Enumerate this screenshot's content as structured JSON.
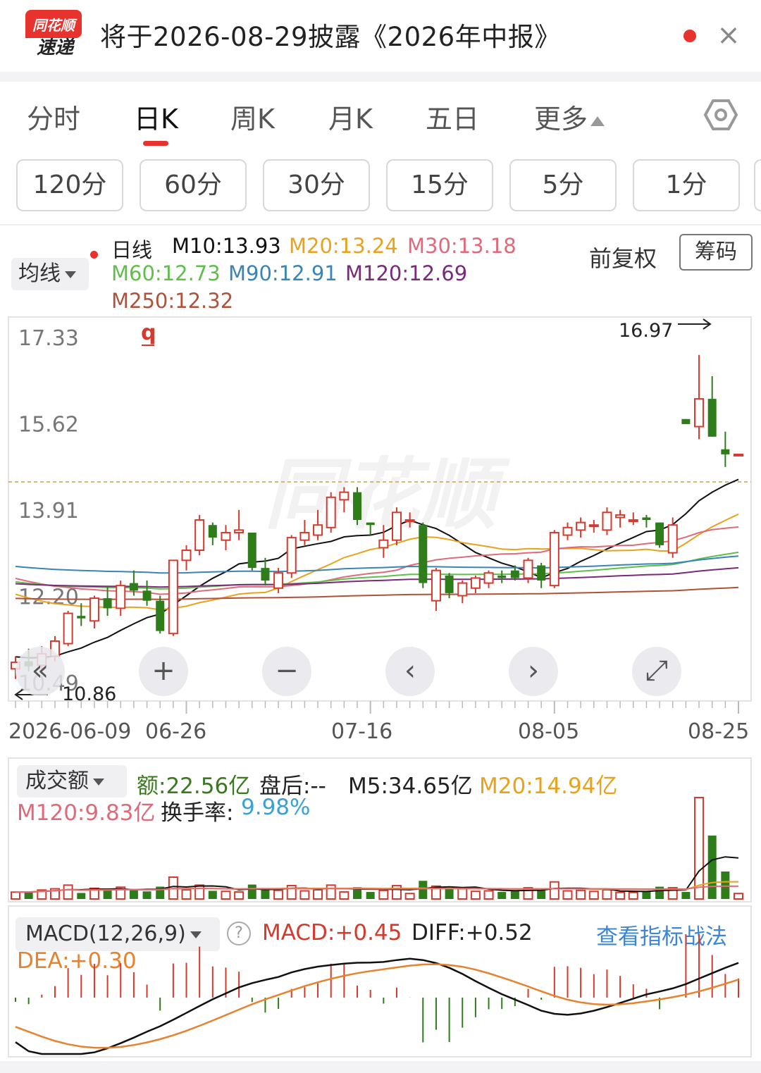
{
  "header": {
    "logo_top": "同花顺",
    "logo_bottom": "速递",
    "title": "将于2026-08-29披露《2026年中报》",
    "close_icon": "close-icon",
    "dot_color": "#e8322e"
  },
  "tabs": [
    {
      "label": "分时"
    },
    {
      "label": "日K"
    },
    {
      "label": "周K"
    },
    {
      "label": "月K"
    },
    {
      "label": "五日"
    },
    {
      "label": "更多"
    }
  ],
  "active_tab": "日K",
  "intervals": [
    "120分",
    "60分",
    "30分",
    "15分",
    "5分",
    "1分"
  ],
  "ma_legend": {
    "selector": "均线",
    "period": "日线",
    "items": [
      {
        "text": "M10:13.93",
        "color": "#111111"
      },
      {
        "text": "M20:13.24",
        "color": "#e8a21e"
      },
      {
        "text": "M30:13.18",
        "color": "#e06a7a"
      },
      {
        "text": "M60:12.73",
        "color": "#5fbf4a"
      },
      {
        "text": "M90:12.91",
        "color": "#3a85b8"
      },
      {
        "text": "M120:12.69",
        "color": "#7a2a7a"
      },
      {
        "text": "M250:12.32",
        "color": "#b0523a"
      }
    ],
    "adjust": "前复权",
    "chips_button": "筹码"
  },
  "price_chart": {
    "y_ticks": [
      "17.33",
      "15.62",
      "13.91",
      "12.20",
      "10.49"
    ],
    "max_label": "16.97",
    "min_label": "10.86",
    "marker": "q",
    "watermark": "同花顺",
    "x_ticks": [
      "2026-06-09",
      "06-26",
      "07-16",
      "08-05",
      "08-25"
    ],
    "nav_buttons": [
      "«",
      "+",
      "−",
      "‹",
      "›",
      "⤢"
    ]
  },
  "volume": {
    "selector": "成交额",
    "line1": [
      {
        "text": "额:22.56亿",
        "color": "#3a7a1e"
      },
      {
        "text": "盘后:--",
        "color": "#222222"
      },
      {
        "text": "M5:34.65亿",
        "color": "#222222"
      },
      {
        "text": "M20:14.94亿",
        "color": "#e8a21e"
      }
    ],
    "m120": "M120:9.83亿",
    "turnover_label": "换手率:",
    "turnover_value": "9.98%"
  },
  "macd": {
    "selector": "MACD(12,26,9)",
    "macd": "MACD:+0.45",
    "diff": "DIFF:+0.52",
    "dea": "DEA:+0.30",
    "strategy_link": "查看指标战法"
  },
  "chart_data": {
    "type": "candlestick",
    "x": [
      "2026-06-09",
      "06-10",
      "06-11",
      "06-12",
      "06-13",
      "06-16",
      "06-17",
      "06-18",
      "06-19",
      "06-20",
      "06-23",
      "06-24",
      "06-25",
      "06-26",
      "06-27",
      "06-30",
      "07-01",
      "07-02",
      "07-03",
      "07-04",
      "07-07",
      "07-08",
      "07-09",
      "07-10",
      "07-11",
      "07-14",
      "07-15",
      "07-16",
      "07-17",
      "07-18",
      "07-21",
      "07-22",
      "07-23",
      "07-24",
      "07-25",
      "07-28",
      "07-29",
      "07-30",
      "07-31",
      "08-01",
      "08-04",
      "08-05",
      "08-06",
      "08-07",
      "08-08",
      "08-11",
      "08-12",
      "08-13",
      "08-14",
      "08-15",
      "08-18",
      "08-19",
      "08-20",
      "08-21",
      "08-22",
      "08-25"
    ],
    "ohlc": [
      [
        10.75,
        11.0,
        10.55,
        10.88
      ],
      [
        10.9,
        11.15,
        10.7,
        10.8
      ],
      [
        10.82,
        11.2,
        10.65,
        11.05
      ],
      [
        11.0,
        11.4,
        10.9,
        11.3
      ],
      [
        11.25,
        11.9,
        11.2,
        11.85
      ],
      [
        11.8,
        12.05,
        11.6,
        11.75
      ],
      [
        11.7,
        12.2,
        11.55,
        12.15
      ],
      [
        12.15,
        12.4,
        11.8,
        11.95
      ],
      [
        11.95,
        12.5,
        11.8,
        12.4
      ],
      [
        12.45,
        12.7,
        12.2,
        12.3
      ],
      [
        12.3,
        12.5,
        12.0,
        12.1
      ],
      [
        12.1,
        12.2,
        11.45,
        11.5
      ],
      [
        11.45,
        12.9,
        11.4,
        12.9
      ],
      [
        12.9,
        13.2,
        12.7,
        13.1
      ],
      [
        13.1,
        13.8,
        13.0,
        13.7
      ],
      [
        13.6,
        13.65,
        13.2,
        13.35
      ],
      [
        13.3,
        13.6,
        13.1,
        13.45
      ],
      [
        13.45,
        13.9,
        13.3,
        13.5
      ],
      [
        13.45,
        13.45,
        12.7,
        12.75
      ],
      [
        12.75,
        12.95,
        12.4,
        12.5
      ],
      [
        12.35,
        12.75,
        12.25,
        12.65
      ],
      [
        12.65,
        13.4,
        12.55,
        13.35
      ],
      [
        13.3,
        13.7,
        13.2,
        13.45
      ],
      [
        13.4,
        13.9,
        13.3,
        13.6
      ],
      [
        13.55,
        14.25,
        13.45,
        14.15
      ],
      [
        14.1,
        14.35,
        13.85,
        14.25
      ],
      [
        14.25,
        14.35,
        13.6,
        13.7
      ],
      [
        13.65,
        13.65,
        13.4,
        13.6
      ],
      [
        13.15,
        13.6,
        12.95,
        13.3
      ],
      [
        13.3,
        13.95,
        13.2,
        13.85
      ],
      [
        13.7,
        13.85,
        13.55,
        13.7
      ],
      [
        13.6,
        13.65,
        12.35,
        12.45
      ],
      [
        12.1,
        12.75,
        11.9,
        12.7
      ],
      [
        12.6,
        12.65,
        12.15,
        12.25
      ],
      [
        12.2,
        12.5,
        12.05,
        12.45
      ],
      [
        12.35,
        12.6,
        12.25,
        12.55
      ],
      [
        12.45,
        12.7,
        12.35,
        12.65
      ],
      [
        12.6,
        12.7,
        12.45,
        12.55
      ],
      [
        12.7,
        12.8,
        12.5,
        12.55
      ],
      [
        12.55,
        12.95,
        12.45,
        12.9
      ],
      [
        12.8,
        12.85,
        12.35,
        12.5
      ],
      [
        12.4,
        13.5,
        12.35,
        13.45
      ],
      [
        13.4,
        13.65,
        13.3,
        13.55
      ],
      [
        13.5,
        13.75,
        13.35,
        13.65
      ],
      [
        13.6,
        13.7,
        13.45,
        13.6
      ],
      [
        13.5,
        13.95,
        13.4,
        13.85
      ],
      [
        13.75,
        13.9,
        13.55,
        13.8
      ],
      [
        13.7,
        13.85,
        13.6,
        13.7
      ],
      [
        13.75,
        13.8,
        13.55,
        13.7
      ],
      [
        13.65,
        13.65,
        13.15,
        13.2
      ],
      [
        13.05,
        13.75,
        12.95,
        13.6
      ],
      [
        15.7,
        15.7,
        15.6,
        15.6
      ],
      [
        15.55,
        16.97,
        15.3,
        16.1
      ],
      [
        16.1,
        16.55,
        15.35,
        15.35
      ],
      [
        15.1,
        15.45,
        14.75,
        15.0
      ],
      [
        15.0,
        15.0,
        15.0,
        15.0
      ]
    ],
    "y_range": [
      10.49,
      17.33
    ],
    "volume_series": [
      {
        "name": "额",
        "unit": "亿"
      }
    ]
  }
}
